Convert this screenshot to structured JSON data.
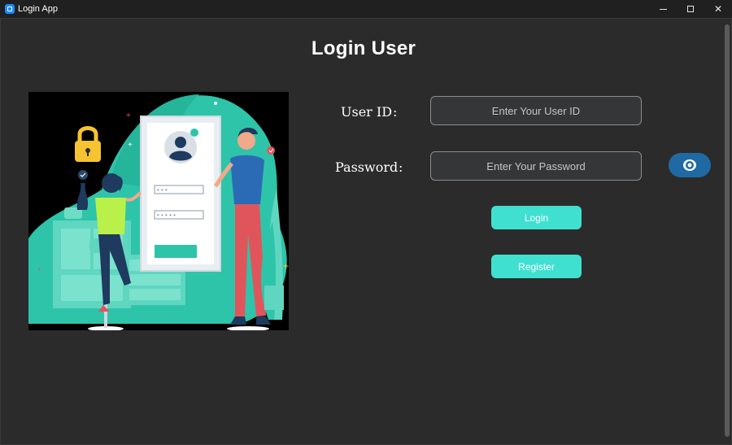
{
  "window": {
    "title": "Login App",
    "controls": [
      "minimize-icon",
      "maximize-icon",
      "close-icon"
    ]
  },
  "page": {
    "title": "Login User"
  },
  "form": {
    "user_id": {
      "label": "User ID",
      "colon": ":",
      "placeholder": "Enter Your User ID",
      "value": ""
    },
    "password": {
      "label": "Password",
      "colon": ":",
      "placeholder": "Enter Your Password",
      "value": "",
      "toggle_icon": "eye-icon"
    },
    "login_label": "Login",
    "register_label": "Register"
  },
  "colors": {
    "accent": "#40e0d0",
    "toggle": "#1f6aa5",
    "background": "#2b2b2b",
    "illustration_teal": "#2ec4a9",
    "illustration_red": "#e0555c",
    "illustration_lime": "#b9f04a"
  }
}
